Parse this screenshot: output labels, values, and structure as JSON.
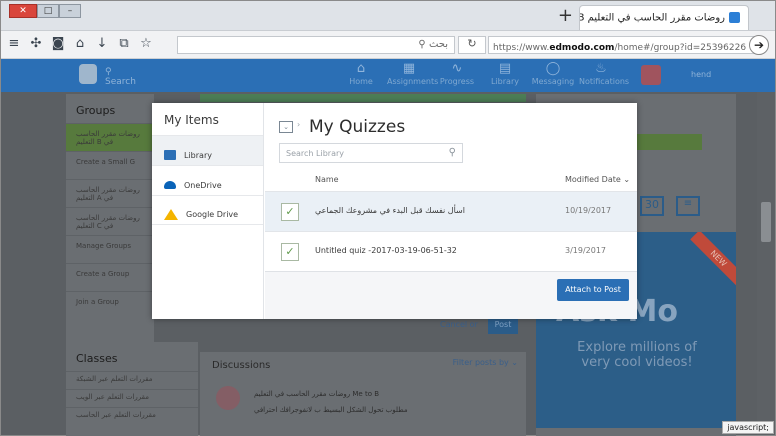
{
  "browser": {
    "tab_title": "روضات مقرر الحاسب في التعليم B",
    "tab_close": "×",
    "new_tab": "+",
    "search_text": "بحث",
    "url_prefix": "https://www.",
    "url_domain": "edmodo.com",
    "url_path": "/home#/group?id=25396226"
  },
  "appnav": {
    "search_placeholder": "Search",
    "items": [
      {
        "label": "Home",
        "icon": "home-icon"
      },
      {
        "label": "Assignments",
        "icon": "assignments-icon"
      },
      {
        "label": "Progress",
        "icon": "progress-icon"
      },
      {
        "label": "Library",
        "icon": "library-icon"
      },
      {
        "label": "Messaging",
        "icon": "messaging-icon"
      },
      {
        "label": "Notifications",
        "icon": "notifications-icon"
      }
    ],
    "user": "hend"
  },
  "background": {
    "groups_title": "Groups",
    "groups": [
      "روضات مقرر الحاسب في B التعليم",
      "Create a Small G",
      "روضات مقرر الحاسب في A التعليم",
      "روضات مقرر الحاسب في C التعليم",
      "Manage Groups",
      "Create a Group",
      "Join a Group"
    ],
    "classes_title": "Classes",
    "classes": [
      "مقررات التعلم عبر الشبكة",
      "مقررات التعلم عبر الويب",
      "مقررات التعلم عبر الحاسب"
    ],
    "discussions_title": "Discussions",
    "filter_label": "Filter posts by",
    "post_header": "Me to B روضات مقرر الحاسب في التعليم",
    "post_text": "مطلوب تحول الشكل البسيط ب لانفوجرافك احترافي",
    "cancel_label": "Cancel or",
    "post_label": "Post",
    "ad_text": "Ask Mo",
    "ad_sub": "Explore millions of very cool videos!",
    "ad_badge": "NEW",
    "badge_30": "30",
    "status_bar": "javascript;"
  },
  "modal": {
    "sidebar_title": "My Items",
    "sidebar_items": [
      {
        "label": "Library",
        "icon": "library-book-icon",
        "color": "#2b6fb5"
      },
      {
        "label": "OneDrive",
        "icon": "onedrive-cloud-icon",
        "color": "#0a63b8"
      },
      {
        "label": "Google Drive",
        "icon": "google-drive-icon",
        "color": "#f4b400"
      }
    ],
    "title": "My Quizzes",
    "search_placeholder": "Search Library",
    "col_name": "Name",
    "col_date": "Modified Date ⌄",
    "rows": [
      {
        "name": "اسأل نفسك قبل البدء في مشروعك الجماعي",
        "date": "10/19/2017"
      },
      {
        "name": "Untitled quiz -2017-03-19-06-51-32",
        "date": "3/19/2017"
      }
    ],
    "attach_label": "Attach to Post"
  }
}
